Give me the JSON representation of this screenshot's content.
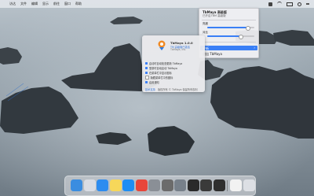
{
  "menubar": {
    "apple": "",
    "items": [
      "访达",
      "文件",
      "编辑",
      "显示",
      "前往",
      "窗口",
      "帮助"
    ],
    "right_clock": "周一"
  },
  "tb_menu": {
    "title": "TbMaya 高级版",
    "subtitle": "已开启TBM 高级版",
    "slider1_label": "亮度",
    "slider1_value": 0.85,
    "slider2_label": "对比",
    "slider2_value": 0.7,
    "highlight_label": "更新",
    "quit_label": "退出 TbMaya"
  },
  "about": {
    "app_name": "TbMaya 1.0.0",
    "line2": "TM 高级版已激活",
    "line3": "TbMaya, Inc.",
    "options": [
      {
        "label": "启动时自动检查更新 TbMaya",
        "checked": true
      },
      {
        "label": "登录时自动启动 TbMaya",
        "checked": true
      },
      {
        "label": "在菜单栏中显示图标",
        "checked": true
      },
      {
        "label": "隐藏菜单栏中的图标",
        "checked": false
      },
      {
        "label": "启用通知",
        "checked": true
      }
    ],
    "footer_link": "技术支持",
    "footer_text": "版权所有 © TbMaya 保留所有权利"
  },
  "dock": {
    "apps": [
      {
        "name": "finder-icon",
        "color": "#3b8de0"
      },
      {
        "name": "launchpad-icon",
        "color": "#d9dce3"
      },
      {
        "name": "safari-icon",
        "color": "#2d8cf0"
      },
      {
        "name": "notes-icon",
        "color": "#f6d75a"
      },
      {
        "name": "app-store-icon",
        "color": "#1e8ef3"
      },
      {
        "name": "chrome-icon",
        "color": "#e8463a"
      },
      {
        "name": "sys-prefs-icon",
        "color": "#8a8f96"
      },
      {
        "name": "script-editor-icon",
        "color": "#6b6b6b"
      },
      {
        "name": "gear-icon",
        "color": "#77808a"
      },
      {
        "name": "spotify-icon",
        "color": "#2a2a2a"
      },
      {
        "name": "dashboard-icon",
        "color": "#3a3a3a"
      },
      {
        "name": "terminal-printer-icon",
        "color": "#2f2f2f"
      },
      {
        "name": "preview-icon",
        "color": "#f2f2f2"
      },
      {
        "name": "trash-icon",
        "color": "#dcdfe4"
      }
    ]
  }
}
